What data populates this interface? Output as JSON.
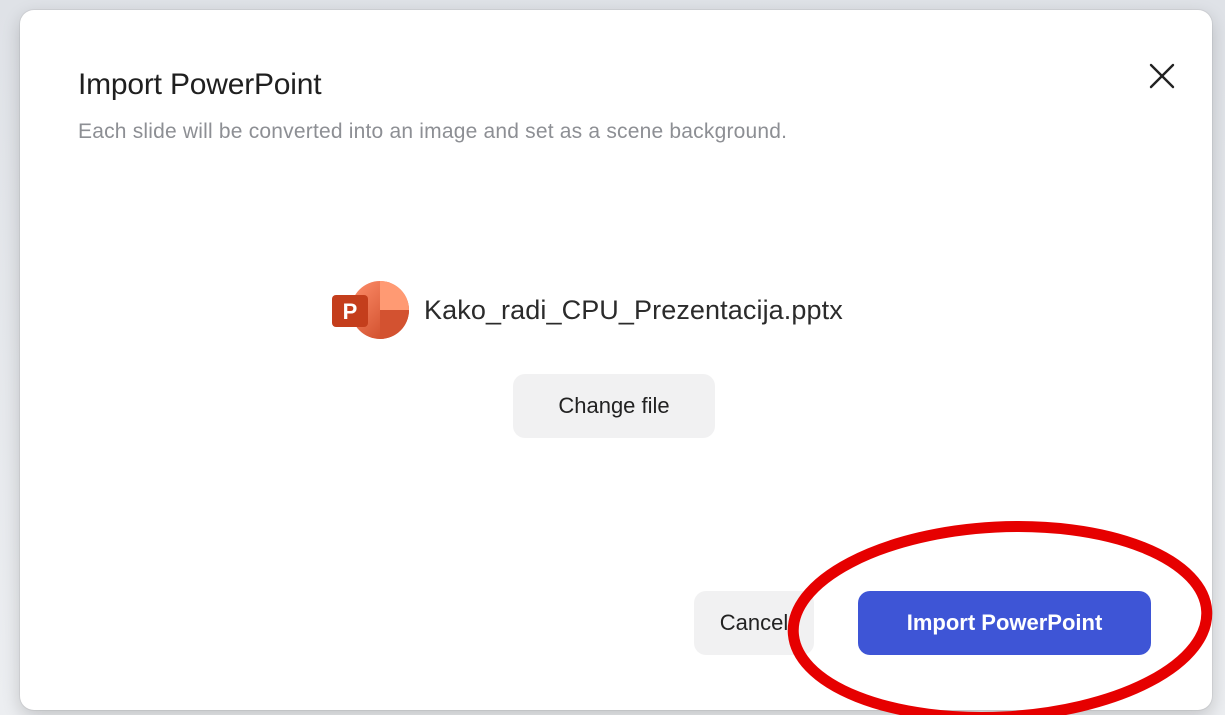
{
  "dialog": {
    "title": "Import PowerPoint",
    "subtitle": "Each slide will be converted into an image and set as a scene background.",
    "close_icon": "close-icon"
  },
  "file": {
    "icon": "powerpoint-icon",
    "name": "Kako_radi_CPU_Prezentacija.pptx"
  },
  "buttons": {
    "change_file": "Change file",
    "cancel": "Cancel",
    "import": "Import PowerPoint"
  },
  "colors": {
    "accent": "#3e55d6",
    "annotation": "#e60000",
    "powerpoint_orange": "#e0542f"
  }
}
